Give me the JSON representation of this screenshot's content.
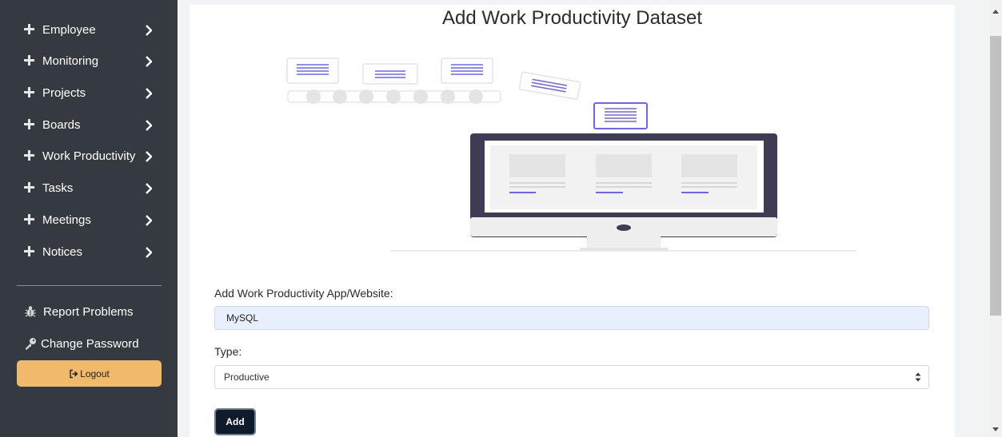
{
  "sidebar": {
    "items": [
      {
        "label": "Employee"
      },
      {
        "label": "Monitoring"
      },
      {
        "label": "Projects"
      },
      {
        "label": "Boards"
      },
      {
        "label": "Work Productivity"
      },
      {
        "label": "Tasks"
      },
      {
        "label": "Meetings"
      },
      {
        "label": "Notices"
      }
    ],
    "report_problems": "Report Problems",
    "change_password": "Change Password",
    "logout": "Logout"
  },
  "main": {
    "title": "Add Work Productivity Dataset",
    "app_label": "Add Work Productivity App/Website:",
    "app_value": "MySQL",
    "type_label": "Type:",
    "type_selected": "Productive",
    "add_button": "Add"
  },
  "colors": {
    "sidebar_bg": "#343a40",
    "logout_bg": "#f0ba6a",
    "input_bg": "#e8f0fe",
    "button_bg": "#0d1b2a",
    "accent": "#6c63ff"
  },
  "icons": {
    "nav": "plus-icon",
    "nav_arrow": "chevron-right-icon",
    "report": "bug-icon",
    "password": "key-icon",
    "logout": "sign-out-icon"
  }
}
